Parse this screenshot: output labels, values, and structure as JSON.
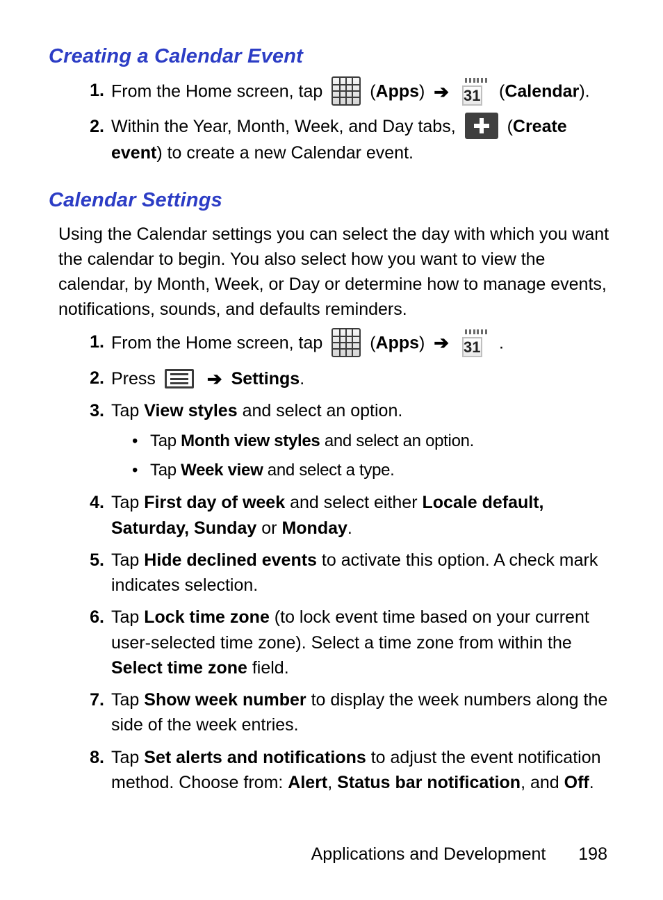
{
  "section1": {
    "title": "Creating a Calendar Event",
    "step1": {
      "lead": "From the Home screen, tap ",
      "apps_label": "Apps",
      "arrow": "➔",
      "cal_number": "31",
      "cal_label": "Calendar",
      "tail_open": " (",
      "tail_close": ")."
    },
    "step2": {
      "lead": "Within the Year, Month, Week, and Day tabs, ",
      "create_label": "Create event",
      "tail_open": " (",
      "tail_close": ") to create a new Calendar event."
    }
  },
  "section2": {
    "title": "Calendar Settings",
    "intro": "Using the Calendar settings you can select the day with which you want the calendar to begin. You also select how you want to view the calendar, by Month, Week, or Day or determine how to manage events, notifications, sounds, and defaults reminders.",
    "step1": {
      "lead": "From the Home screen, tap ",
      "apps_label": "Apps",
      "arrow": "➔",
      "cal_number": "31",
      "period": " ."
    },
    "step2": {
      "press": "Press ",
      "arrow": "➔",
      "settings_label": "Settings",
      "period": "."
    },
    "step3": {
      "tap": "Tap ",
      "bold": "View styles",
      "rest": " and select an option.",
      "b1_tap": "Tap ",
      "b1_bold": "Month view styles",
      "b1_rest": " and select an option.",
      "b2_tap": "Tap ",
      "b2_bold": "Week view",
      "b2_rest": " and select a type."
    },
    "step4": {
      "tap": "Tap ",
      "bold1": "First day of week",
      "mid": " and select either ",
      "bold2": "Locale default, Saturday, Sunday",
      "or": " or ",
      "bold3": "Monday",
      "period": "."
    },
    "step5": {
      "tap": "Tap ",
      "bold": "Hide declined events",
      "rest": " to activate this option. A check mark indicates selection."
    },
    "step6": {
      "tap": "Tap ",
      "bold1": "Lock time zone",
      "mid": " (to lock event time based on your current user-selected time zone). Select a time zone from within the ",
      "bold2": "Select time zone",
      "rest": " field."
    },
    "step7": {
      "tap": "Tap ",
      "bold": "Show week number",
      "rest": " to display the week numbers along the side of the week entries."
    },
    "step8": {
      "tap": "Tap ",
      "bold1": "Set alerts and notifications",
      "mid1": " to adjust the event notification method. Choose from: ",
      "bold2": "Alert",
      "sep1": ", ",
      "bold3": "Status bar notification",
      "sep2": ", and ",
      "bold4": "Off",
      "period": "."
    }
  },
  "footer": {
    "section": "Applications and Development",
    "page": "198"
  }
}
